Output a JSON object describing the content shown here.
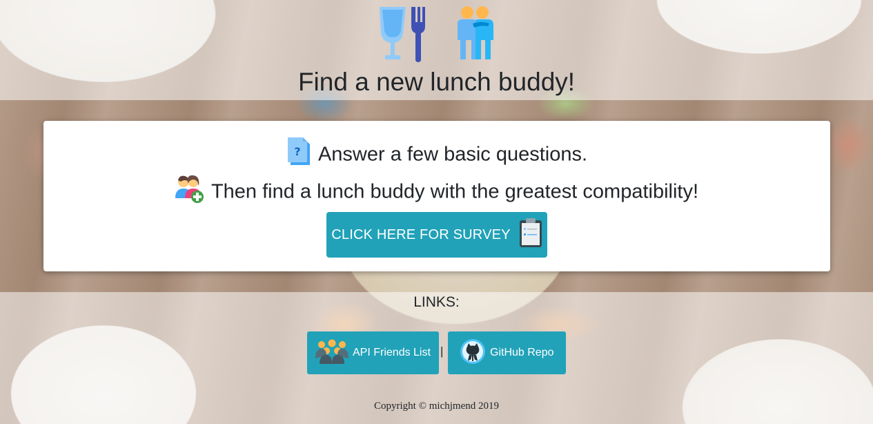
{
  "hero": {
    "title": "Find a new lunch buddy!",
    "icons": [
      "glass-fork-icon",
      "two-people-icon"
    ]
  },
  "card": {
    "line1": {
      "icon": "question-document-icon",
      "text": "Answer a few basic questions."
    },
    "line2": {
      "icon": "add-people-icon",
      "text": "Then find a lunch buddy with the greatest compatibility!"
    },
    "survey_button": {
      "label": "CLICK HERE FOR SURVEY",
      "icon": "clipboard-icon"
    }
  },
  "links": {
    "label": "LINKS:",
    "separator": "|",
    "api": {
      "label": "API Friends List",
      "icon": "group-people-icon"
    },
    "github": {
      "label": "GitHub Repo",
      "icon": "github-octocat-icon"
    }
  },
  "footer": {
    "copyright": "Copyright © michjmend 2019"
  },
  "colors": {
    "accent": "#21a2b8",
    "text": "#212529",
    "card_bg": "#ffffff"
  }
}
